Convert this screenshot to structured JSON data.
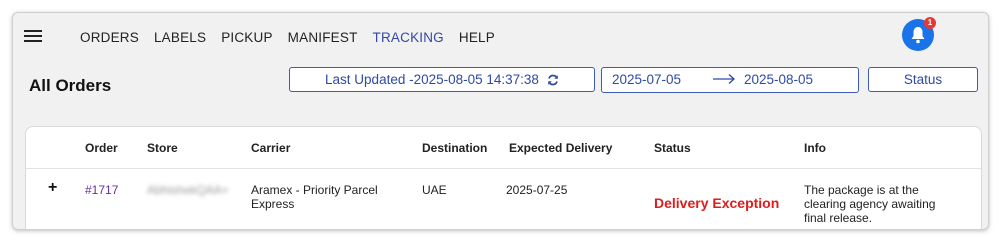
{
  "nav": {
    "items": [
      "ORDERS",
      "LABELS",
      "PICKUP",
      "MANIFEST",
      "TRACKING",
      "HELP"
    ],
    "active": "TRACKING"
  },
  "notifications": {
    "count": "1",
    "icon": "bell-icon"
  },
  "page": {
    "title": "All Orders"
  },
  "toolbar": {
    "last_updated": "Last Updated -2025-08-05 14:37:38",
    "refresh_icon": "refresh-icon",
    "date_from": "2025-07-05",
    "date_to": "2025-08-05",
    "status_label": "Status"
  },
  "table": {
    "columns": [
      "Order",
      "Store",
      "Carrier",
      "Destination",
      "Expected Delivery",
      "Status",
      "Info"
    ],
    "rows": [
      {
        "expand": "+",
        "order": "#1717",
        "store": "AbhishekQAA+",
        "carrier": "Aramex - Priority Parcel Express",
        "destination": "UAE",
        "expected_delivery": "2025-07-25",
        "status": "Delivery Exception",
        "info": "The package is at the clearing agency awaiting final release."
      }
    ]
  },
  "colors": {
    "accent": "#3347a8",
    "status_exception": "#e01b1b",
    "bell_bg": "#1a73e8"
  }
}
